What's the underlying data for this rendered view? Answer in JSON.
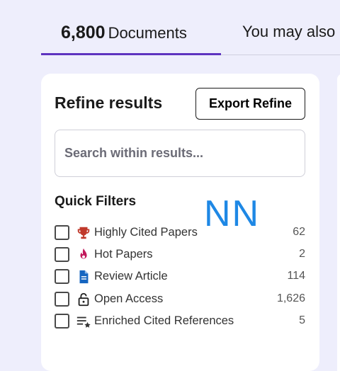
{
  "tabs": {
    "documents_count": "6,800",
    "documents_label": "Documents",
    "also_label": "You may also"
  },
  "panel": {
    "title": "Refine results",
    "export_label": "Export Refine",
    "search_placeholder": "Search within results..."
  },
  "quick_filters": {
    "title": "Quick Filters",
    "overlay_text": "NN",
    "items": [
      {
        "label": "Highly Cited Papers",
        "count": "62",
        "icon": "trophy-icon"
      },
      {
        "label": "Hot Papers",
        "count": "2",
        "icon": "flame-icon"
      },
      {
        "label": "Review Article",
        "count": "114",
        "icon": "document-icon"
      },
      {
        "label": "Open Access",
        "count": "1,626",
        "icon": "open-lock-icon"
      },
      {
        "label": "Enriched Cited References",
        "count": "5",
        "icon": "list-star-icon"
      }
    ]
  },
  "colors": {
    "accent": "#5e33bf",
    "trophy": "#c0392b",
    "flame": "#c2185b",
    "document": "#1565c0",
    "overlay": "#1e88e5"
  }
}
